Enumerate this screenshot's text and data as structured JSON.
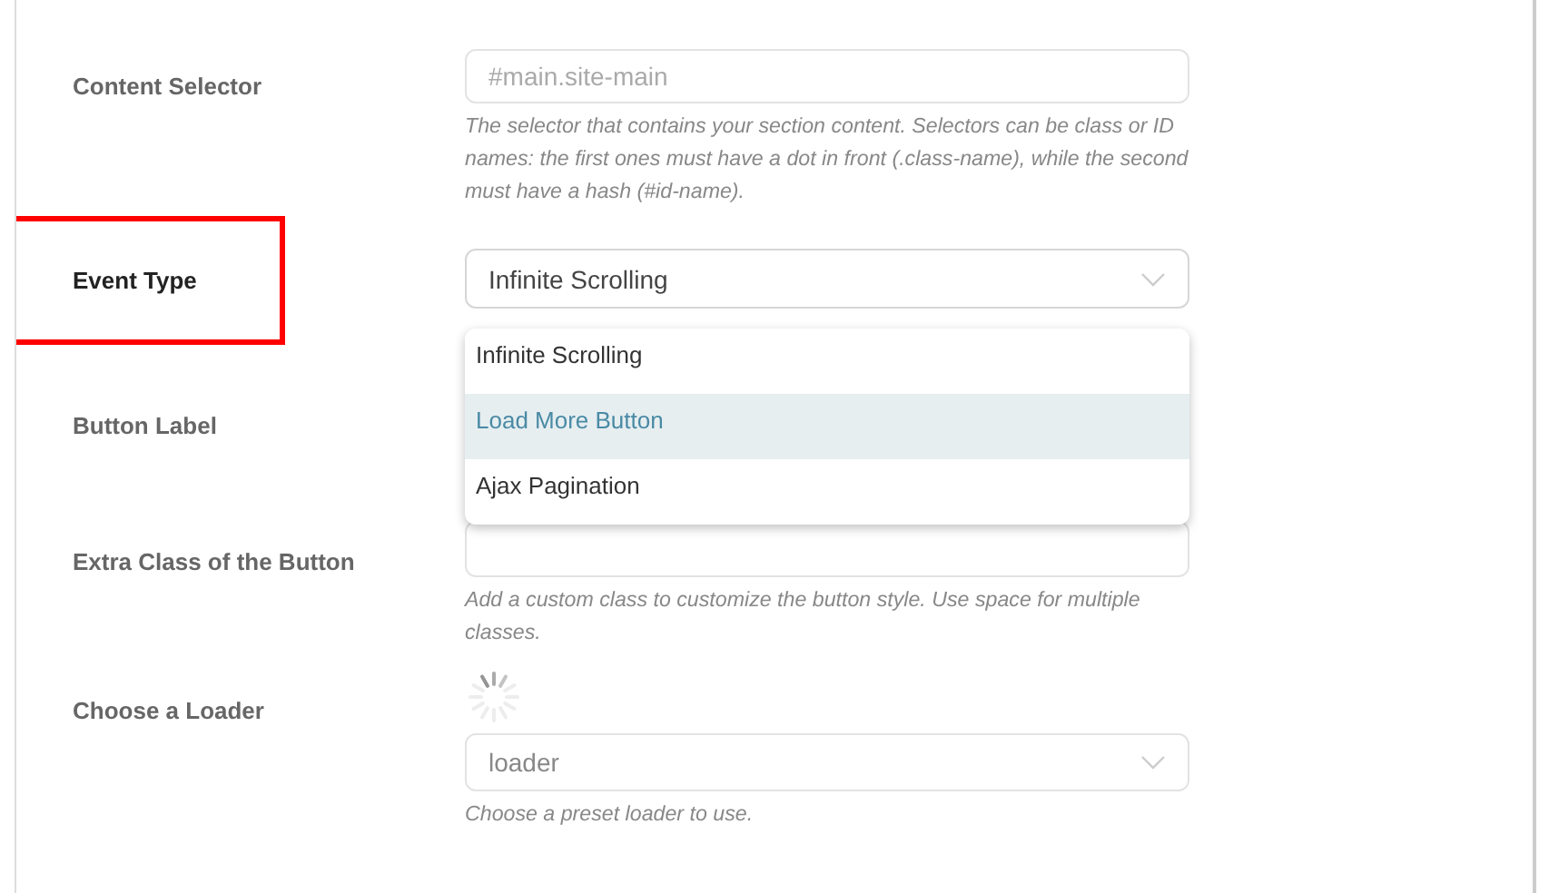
{
  "fields": [
    {
      "label": "Content Selector",
      "kind": "input",
      "highlighted": false,
      "placeholder": "#main.site-main",
      "help": "The selector that contains your section content. Selectors can be class or ID names: the first ones must have a dot in front (.class-name), while the second must have a hash (#id-name)."
    },
    {
      "label": "Event Type",
      "kind": "select",
      "highlighted": true,
      "value": "Infinite Scrolling",
      "expanded": true,
      "options": [
        {
          "label": "Infinite Scrolling",
          "hovered": false
        },
        {
          "label": "Load More Button",
          "hovered": true
        },
        {
          "label": "Ajax Pagination",
          "hovered": false
        }
      ]
    },
    {
      "label": "Button Label",
      "kind": "hidden",
      "highlighted": false
    },
    {
      "label": "Extra Class of the Button",
      "kind": "input",
      "highlighted": false,
      "help": "Add a custom class to customize the button style. Use space for multiple classes."
    },
    {
      "label": "Choose a Loader",
      "kind": "loader",
      "highlighted": false,
      "value": "loader",
      "help": "Choose a preset loader to use."
    }
  ]
}
